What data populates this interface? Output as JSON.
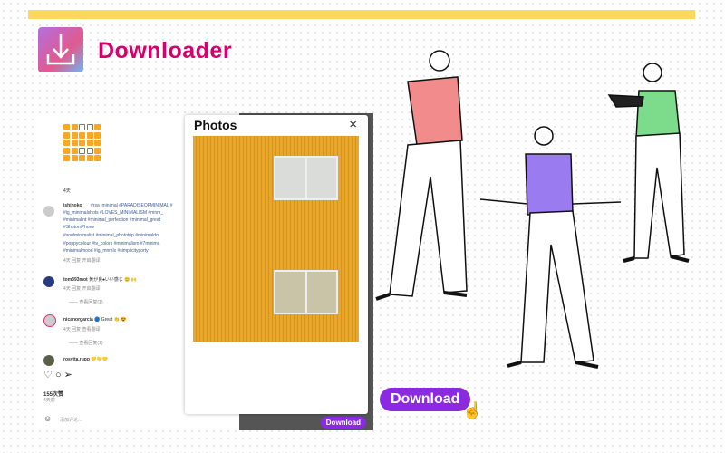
{
  "brand": {
    "name": "Downloader"
  },
  "feed": {
    "time_top": "4天",
    "caption_user": "ishihoko",
    "caption_lines": [
      "#rsa_minimal #PARADISEOFMINIMAL #",
      "#ig_minimalshots #LOVES_MINIMALISM #mnm_",
      "#minimalint #minimal_perfection #minimal_great",
      "#ShotoniPhone",
      "#soulminimalist #minimal_phototrip #minimaldo",
      "#poppycolour #tv_colors #minimalism #7minima",
      "#minimalmood #ig_mnmlx #simplicityporty"
    ],
    "caption_meta": "4天  回复  开启翻译",
    "comments": [
      {
        "user": "tom393mot",
        "text": "黄が良♠いい感じ 😊 🙌",
        "meta": "4天  回复  开启翻译",
        "replies": "—— 查看回复(1)"
      },
      {
        "user": "nicanorgarcia",
        "text": "🔵 Great 👏 😍",
        "meta": "4天  回复  查看翻译",
        "replies": "—— 查看回复(1)"
      },
      {
        "user": "rosvita.rupp",
        "text": "💛💛💛",
        "meta": "",
        "replies": ""
      }
    ],
    "likes": "155次赞",
    "posted": "4天前",
    "comment_placeholder": "添加评论..."
  },
  "popup": {
    "title": "Photos",
    "close": "×",
    "download": "Download"
  },
  "cta": {
    "download": "Download"
  },
  "colors": {
    "accent": "#8a2be2",
    "brand": "#d6006b",
    "bar": "#fdd85d"
  }
}
